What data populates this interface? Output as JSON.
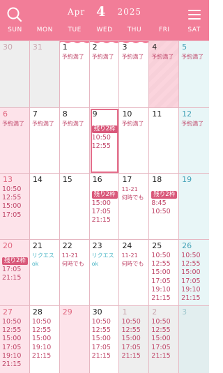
{
  "header": {
    "month_name": "Apr",
    "month_number": "4",
    "year": "2025",
    "colors": {
      "header_bg": "#f27d98",
      "accent": "#d9587a",
      "saturday": "#45a3b8",
      "sunday": "#e0667f"
    },
    "icons": {
      "search": "search-icon",
      "menu": "hamburger-menu-icon"
    }
  },
  "weekdays": [
    "SUN",
    "MON",
    "TUE",
    "WED",
    "THU",
    "FRI",
    "SAT"
  ],
  "weeks": [
    {
      "days": [
        {
          "day": "30",
          "kind": "sun",
          "other": true,
          "lines": []
        },
        {
          "day": "31",
          "kind": "",
          "other": true,
          "lines": []
        },
        {
          "day": "1",
          "kind": "",
          "lines": [
            {
              "t": "予約満了",
              "cls": "small"
            }
          ]
        },
        {
          "day": "2",
          "kind": "",
          "lines": [
            {
              "t": "予約満了",
              "cls": "small"
            }
          ]
        },
        {
          "day": "3",
          "kind": "",
          "lines": [
            {
              "t": "予約満了",
              "cls": "small"
            }
          ]
        },
        {
          "day": "4",
          "kind": "",
          "hatched": true,
          "fade": true,
          "lines": [
            {
              "t": "予約満了",
              "cls": "small"
            }
          ]
        },
        {
          "day": "5",
          "kind": "sat",
          "lines": [
            {
              "t": "予約満了",
              "cls": "small"
            }
          ]
        }
      ]
    },
    {
      "days": [
        {
          "day": "6",
          "kind": "sun",
          "lines": [
            {
              "t": "予約満了",
              "cls": "small"
            }
          ]
        },
        {
          "day": "7",
          "kind": "",
          "lines": [
            {
              "t": "予約満了",
              "cls": "small"
            }
          ]
        },
        {
          "day": "8",
          "kind": "",
          "lines": [
            {
              "t": "予約満了",
              "cls": "small"
            }
          ]
        },
        {
          "day": "9",
          "kind": "",
          "today": true,
          "badge": "残り2枠",
          "lines": [
            {
              "t": "10:50"
            },
            {
              "t": "12:55"
            }
          ]
        },
        {
          "day": "10",
          "kind": "",
          "lines": [
            {
              "t": "予約満了",
              "cls": "small"
            }
          ]
        },
        {
          "day": "11",
          "kind": "",
          "lines": []
        },
        {
          "day": "12",
          "kind": "sat",
          "lines": [
            {
              "t": "予約満了",
              "cls": "small"
            }
          ]
        }
      ]
    },
    {
      "days": [
        {
          "day": "13",
          "kind": "sun",
          "lines": [
            {
              "t": "10:50"
            },
            {
              "t": "12:55"
            },
            {
              "t": "15:00"
            },
            {
              "t": "17:05"
            }
          ]
        },
        {
          "day": "14",
          "kind": "",
          "lines": []
        },
        {
          "day": "15",
          "kind": "",
          "lines": []
        },
        {
          "day": "16",
          "kind": "",
          "badge": "残り2枠",
          "lines": [
            {
              "t": "15:00"
            },
            {
              "t": "17:05"
            },
            {
              "t": "21:15"
            }
          ]
        },
        {
          "day": "17",
          "kind": "",
          "lines": [
            {
              "t": "11-21",
              "cls": "small"
            },
            {
              "t": "何時でも",
              "cls": "small"
            }
          ]
        },
        {
          "day": "18",
          "kind": "",
          "badge": "残り2枠",
          "lines": [
            {
              "t": "8:45"
            },
            {
              "t": "10:50"
            }
          ]
        },
        {
          "day": "19",
          "kind": "sat",
          "lines": []
        }
      ]
    },
    {
      "days": [
        {
          "day": "20",
          "kind": "sun",
          "badge": "残り2枠",
          "lines": [
            {
              "t": "17:05"
            },
            {
              "t": "21:15"
            }
          ]
        },
        {
          "day": "21",
          "kind": "",
          "lines": [
            {
              "t": "リクエス",
              "cls": "small note"
            },
            {
              "t": "ok",
              "cls": "small note"
            }
          ]
        },
        {
          "day": "22",
          "kind": "",
          "lines": [
            {
              "t": "11-21",
              "cls": "small"
            },
            {
              "t": "何時でも",
              "cls": "small"
            }
          ]
        },
        {
          "day": "23",
          "kind": "",
          "lines": [
            {
              "t": "リクエス",
              "cls": "small note"
            },
            {
              "t": "ok",
              "cls": "small note"
            }
          ]
        },
        {
          "day": "24",
          "kind": "",
          "lines": [
            {
              "t": "11-21",
              "cls": "small"
            },
            {
              "t": "何時でも",
              "cls": "small"
            }
          ]
        },
        {
          "day": "25",
          "kind": "",
          "lines": [
            {
              "t": "10:50"
            },
            {
              "t": "12:55"
            },
            {
              "t": "15:00"
            },
            {
              "t": "17:05"
            },
            {
              "t": "19:10"
            },
            {
              "t": "21:15"
            }
          ]
        },
        {
          "day": "26",
          "kind": "sat",
          "lines": [
            {
              "t": "10:50"
            },
            {
              "t": "12:55"
            },
            {
              "t": "15:00"
            },
            {
              "t": "17:05"
            },
            {
              "t": "19:10"
            },
            {
              "t": "21:15"
            }
          ]
        }
      ]
    },
    {
      "days": [
        {
          "day": "27",
          "kind": "sun",
          "lines": [
            {
              "t": "10:50"
            },
            {
              "t": "12:55"
            },
            {
              "t": "15:00"
            },
            {
              "t": "17:05"
            },
            {
              "t": "19:10"
            },
            {
              "t": "21:15"
            }
          ]
        },
        {
          "day": "28",
          "kind": "",
          "lines": [
            {
              "t": "10:50"
            },
            {
              "t": "12:55"
            },
            {
              "t": "15:00"
            },
            {
              "t": "19:10"
            },
            {
              "t": "21:15"
            }
          ]
        },
        {
          "day": "29",
          "kind": "sun",
          "lines": []
        },
        {
          "day": "30",
          "kind": "",
          "lines": [
            {
              "t": "10:50"
            },
            {
              "t": "12:55"
            },
            {
              "t": "15:00"
            },
            {
              "t": "17:05"
            },
            {
              "t": "21:15"
            }
          ]
        },
        {
          "day": "1",
          "kind": "",
          "other": true,
          "lines": [
            {
              "t": "10:50"
            },
            {
              "t": "12:55"
            },
            {
              "t": "15:00"
            },
            {
              "t": "17:05"
            },
            {
              "t": "21:15"
            }
          ]
        },
        {
          "day": "2",
          "kind": "",
          "other": true,
          "lines": [
            {
              "t": "10:50"
            },
            {
              "t": "12:55"
            },
            {
              "t": "15:00"
            },
            {
              "t": "17:05"
            },
            {
              "t": "21:15"
            }
          ]
        },
        {
          "day": "3",
          "kind": "sat",
          "other": true,
          "lines": []
        }
      ]
    }
  ]
}
